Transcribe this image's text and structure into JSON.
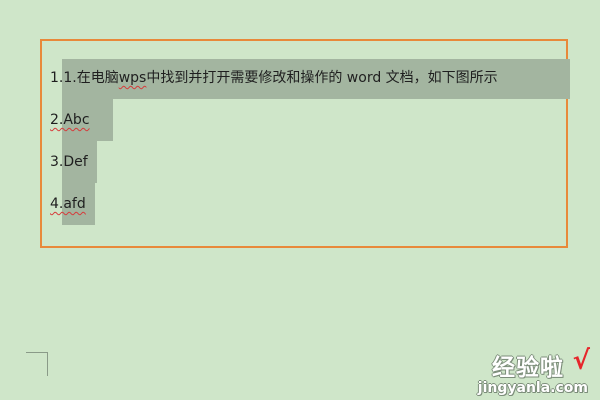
{
  "document": {
    "lines": [
      {
        "num": "1.",
        "before": "1.在电脑 ",
        "wps": "wps",
        "after": " 中找到并打开需要修改和操作的 word 文档，如下图所示"
      },
      {
        "num": "2.",
        "text": "2.Abc"
      },
      {
        "num": "3.",
        "text": "3.Def"
      },
      {
        "num": "4.",
        "text": "4.afd"
      }
    ]
  },
  "watermark": {
    "site_cn": "经验啦",
    "check": "√",
    "url": "jingyanla.com"
  },
  "colors": {
    "background": "#cfe6c9",
    "textbox_border": "#e8893a",
    "selection": "#a3b5a0",
    "spellcheck": "#d63a3a"
  }
}
